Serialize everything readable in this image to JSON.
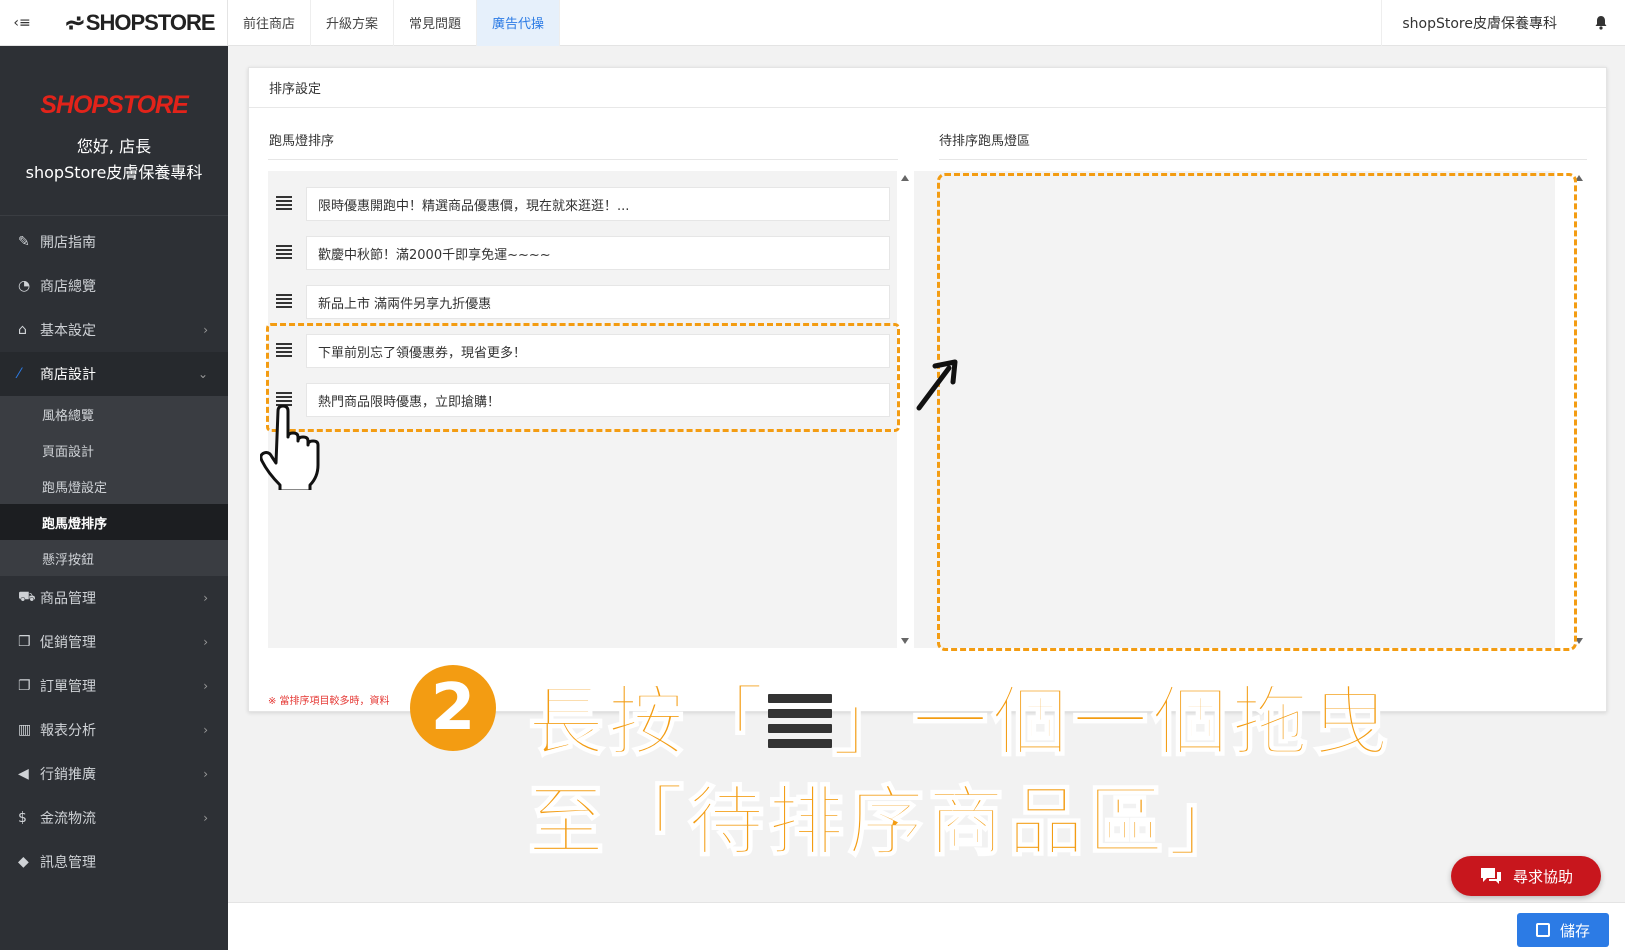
{
  "topbar": {
    "toggle_icon": "≡",
    "logo": "SHOPSTORE",
    "tabs": [
      {
        "label": "前往商店",
        "active": false
      },
      {
        "label": "升級方案",
        "active": false
      },
      {
        "label": "常見問題",
        "active": false
      },
      {
        "label": "廣告代操",
        "active": true
      }
    ],
    "store_name": "shopStore皮膚保養專科"
  },
  "sidebar": {
    "logo": "SHOPSTORE",
    "greeting": "您好, 店長",
    "store_name": "shopStore皮膚保養專科",
    "menu": [
      {
        "label": "開店指南",
        "icon": "wrench-icon"
      },
      {
        "label": "商店總覽",
        "icon": "dashboard-icon"
      },
      {
        "label": "基本設定",
        "icon": "bank-icon"
      },
      {
        "label": "商店設計",
        "icon": "magic-wand-icon"
      },
      {
        "label": "商品管理",
        "icon": "cart-icon"
      },
      {
        "label": "促銷管理",
        "icon": "gift-icon"
      },
      {
        "label": "訂單管理",
        "icon": "copy-icon"
      },
      {
        "label": "報表分析",
        "icon": "bar-chart-icon"
      },
      {
        "label": "行銷推廣",
        "icon": "bullhorn-icon"
      },
      {
        "label": "金流物流",
        "icon": "dollar-icon"
      },
      {
        "label": "訊息管理",
        "icon": "comments-icon"
      }
    ],
    "submenu": [
      "風格總覽",
      "頁面設計",
      "跑馬燈設定",
      "跑馬燈排序",
      "懸浮按鈕"
    ]
  },
  "card": {
    "header": "排序設定",
    "left_title": "跑馬燈排序",
    "right_title": "待排序跑馬燈區",
    "items": [
      "限時優惠開跑中！精選商品優惠價，現在就來逛逛！...",
      "歡慶中秋節！滿2000千即享免運~~~~",
      "新品上市 滿兩件另享九折優惠",
      "下單前別忘了領優惠券，現省更多！",
      "熱門商品限時優惠，立即搶購！"
    ],
    "note": "※ 當排序項目較多時，資料"
  },
  "annotation": {
    "number": "2",
    "line1_before": "長按「",
    "line1_after": "」一個一個拖曳",
    "line2": "至「待排序商品區」",
    "color": "#f39c12"
  },
  "help_button": "尋求協助",
  "save_button": "儲存"
}
